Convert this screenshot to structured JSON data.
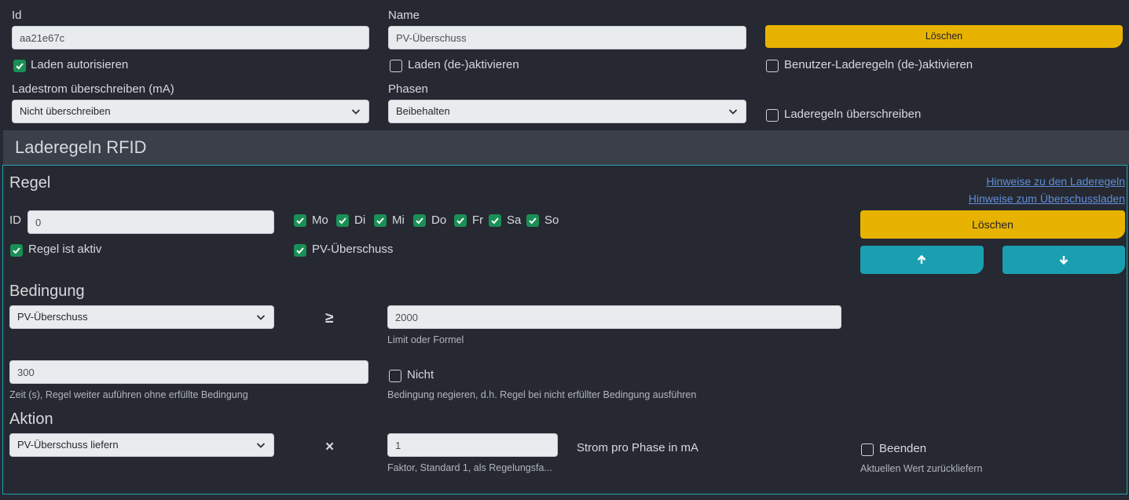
{
  "top": {
    "id_label": "Id",
    "id_value": "aa21e67c",
    "name_label": "Name",
    "name_value": "PV-Überschuss",
    "delete_label": "Löschen",
    "authorize_label": "Laden autorisieren",
    "toggle_charging_label": "Laden (de-)aktivieren",
    "user_rules_label": "Benutzer-Laderegeln (de-)aktivieren",
    "current_override_label": "Ladestrom überschreiben (mA)",
    "current_override_value": "Nicht überschreiben",
    "phases_label": "Phasen",
    "phases_value": "Beibehalten",
    "override_rules_label": "Laderegeln überschreiben"
  },
  "section": {
    "title": "Laderegeln RFID"
  },
  "rule": {
    "title": "Regel",
    "link_rules": "Hinweise zu den Laderegeln",
    "link_surplus": "Hinweise zum Überschussladen",
    "id_label": "ID",
    "id_value": "0",
    "days": [
      "Mo",
      "Di",
      "Mi",
      "Do",
      "Fr",
      "Sa",
      "So"
    ],
    "active_label": "Regel ist aktiv",
    "pv_label": "PV-Überschuss",
    "delete_label": "Löschen"
  },
  "condition": {
    "title": "Bedingung",
    "variable": "PV-Überschuss",
    "operator": "≥",
    "limit_value": "2000",
    "limit_help": "Limit oder Formel",
    "time_value": "300",
    "time_help": "Zeit (s), Regel weiter auführen ohne erfüllte Bedingung",
    "not_label": "Nicht",
    "not_help": "Bedingung negieren, d.h. Regel bei nicht erfüllter Bedingung ausführen"
  },
  "action": {
    "title": "Aktion",
    "type": "PV-Überschuss liefern",
    "operator": "×",
    "factor_value": "1",
    "factor_help": "Faktor, Standard 1, als Regelungsfa...",
    "unit_label": "Strom pro Phase in mA",
    "end_label": "Beenden",
    "end_help": "Aktuellen Wert zurückliefern"
  },
  "colors": {
    "background": "#262931",
    "section_bar": "#3a3f4a",
    "accent_yellow": "#e8b300",
    "accent_teal": "#1a9fb0",
    "check_green": "#1a8f55",
    "link_blue": "#5f8fd9"
  }
}
